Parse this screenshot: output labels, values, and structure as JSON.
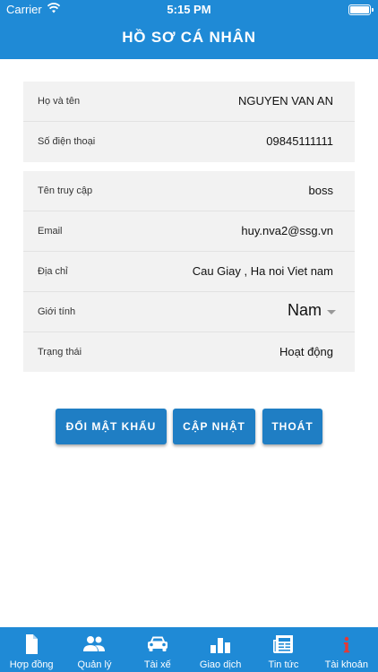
{
  "status_bar": {
    "carrier": "Carrier",
    "time": "5:15 PM"
  },
  "header": {
    "title": "HỒ SƠ CÁ NHÂN"
  },
  "profile": {
    "name": {
      "label": "Họ và tên",
      "value": "NGUYEN VAN AN"
    },
    "phone": {
      "label": "Số điện thoại",
      "value": "09845111111"
    },
    "username": {
      "label": "Tên truy cập",
      "value": "boss"
    },
    "email": {
      "label": "Email",
      "value": "huy.nva2@ssg.vn"
    },
    "address": {
      "label": "Địa chỉ",
      "value": "Cau Giay , Ha noi Viet nam"
    },
    "gender": {
      "label": "Giới tính",
      "value": "Nam"
    },
    "status": {
      "label": "Trạng thái",
      "value": "Hoạt động"
    }
  },
  "actions": {
    "change_password": "ĐỔI MẬT KHẨU",
    "update": "CẬP NHẬT",
    "exit": "THOÁT"
  },
  "tabbar": {
    "items": [
      {
        "label": "Hợp đồng",
        "icon": "document-icon"
      },
      {
        "label": "Quản lý",
        "icon": "people-icon"
      },
      {
        "label": "Tài xế",
        "icon": "car-icon"
      },
      {
        "label": "Giao dịch",
        "icon": "bar-chart-icon"
      },
      {
        "label": "Tin tức",
        "icon": "newspaper-icon"
      },
      {
        "label": "Tài khoản",
        "icon": "info-icon"
      }
    ]
  },
  "colors": {
    "primary": "#1f8ad6",
    "button": "#1f7ec4",
    "card": "#f2f2f2",
    "active_icon": "#e53935"
  }
}
